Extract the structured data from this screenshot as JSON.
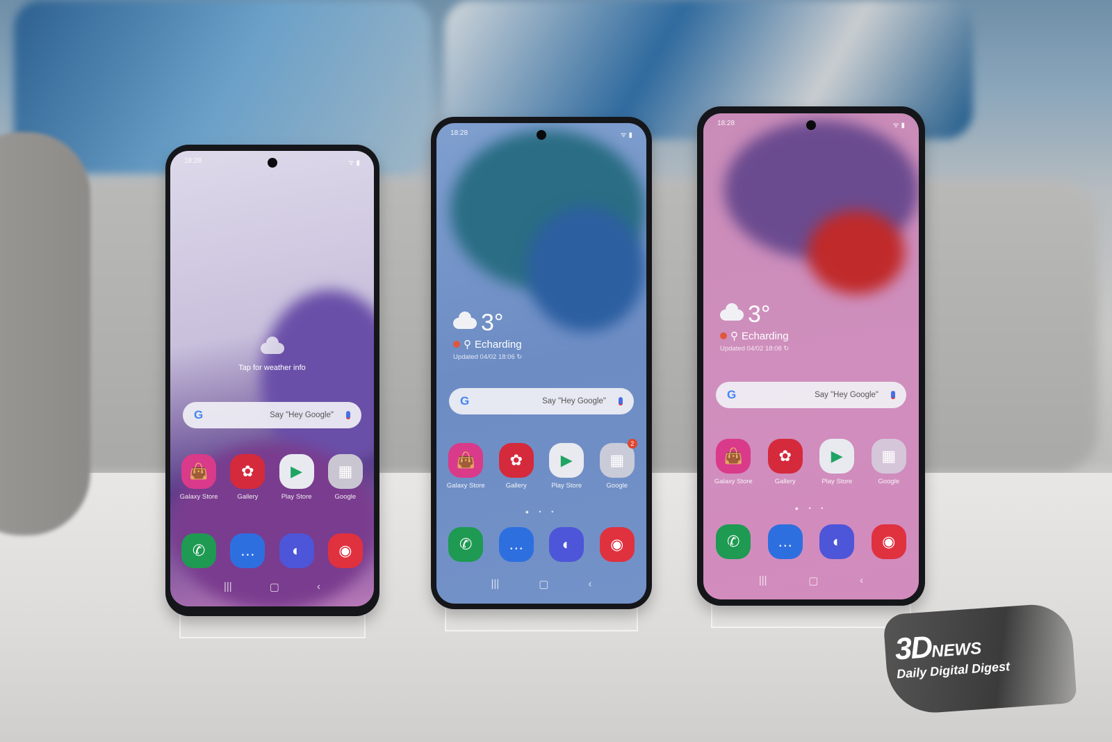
{
  "phones": [
    {
      "time": "18:28",
      "weather_prompt": "Tap for weather info",
      "search_hint": "Say \"Hey Google\"",
      "apps": [
        {
          "label": "Galaxy Store",
          "icon": "shopping-bag-icon",
          "color": "#d93a8a"
        },
        {
          "label": "Gallery",
          "icon": "flower-icon",
          "color": "#d42a3c"
        },
        {
          "label": "Play Store",
          "icon": "play-icon",
          "color": "#e8eaf0"
        },
        {
          "label": "Google",
          "icon": "folder-icon",
          "color": "#c9c6d2",
          "badge": ""
        }
      ],
      "dock": [
        {
          "icon": "phone-icon",
          "color": "#1e9a52"
        },
        {
          "icon": "messages-icon",
          "color": "#2e6fe0"
        },
        {
          "icon": "internet-icon",
          "color": "#4d55d8"
        },
        {
          "icon": "camera-icon",
          "color": "#e0313f"
        }
      ]
    },
    {
      "time": "18:28",
      "temp": "3°",
      "location": "Echarding",
      "updated": "Updated 04/02 18:06",
      "search_hint": "Say \"Hey Google\"",
      "apps": [
        {
          "label": "Galaxy Store",
          "icon": "shopping-bag-icon",
          "color": "#d93a8a"
        },
        {
          "label": "Gallery",
          "icon": "flower-icon",
          "color": "#d42a3c"
        },
        {
          "label": "Play Store",
          "icon": "play-icon",
          "color": "#e8eaf0"
        },
        {
          "label": "Google",
          "icon": "folder-icon",
          "color": "#c9cbd8",
          "badge": "2"
        }
      ],
      "dock": [
        {
          "icon": "phone-icon",
          "color": "#1e9a52"
        },
        {
          "icon": "messages-icon",
          "color": "#2e6fe0"
        },
        {
          "icon": "internet-icon",
          "color": "#4d55d8"
        },
        {
          "icon": "camera-icon",
          "color": "#e0313f"
        }
      ]
    },
    {
      "time": "18:28",
      "temp": "3°",
      "location": "Echarding",
      "updated": "Updated 04/02 18:08",
      "search_hint": "Say \"Hey Google\"",
      "apps": [
        {
          "label": "Galaxy Store",
          "icon": "shopping-bag-icon",
          "color": "#d93a8a"
        },
        {
          "label": "Gallery",
          "icon": "flower-icon",
          "color": "#d42a3c"
        },
        {
          "label": "Play Store",
          "icon": "play-icon",
          "color": "#e8eaf0"
        },
        {
          "label": "Google",
          "icon": "folder-icon",
          "color": "#d6c6da",
          "badge": ""
        }
      ],
      "dock": [
        {
          "icon": "phone-icon",
          "color": "#1e9a52"
        },
        {
          "icon": "messages-icon",
          "color": "#2e6fe0"
        },
        {
          "icon": "internet-icon",
          "color": "#4d55d8"
        },
        {
          "icon": "camera-icon",
          "color": "#e0313f"
        }
      ]
    }
  ],
  "watermark": {
    "brand": "3D",
    "brand_suffix": "NEWS",
    "tagline": "Daily Digital Digest"
  }
}
